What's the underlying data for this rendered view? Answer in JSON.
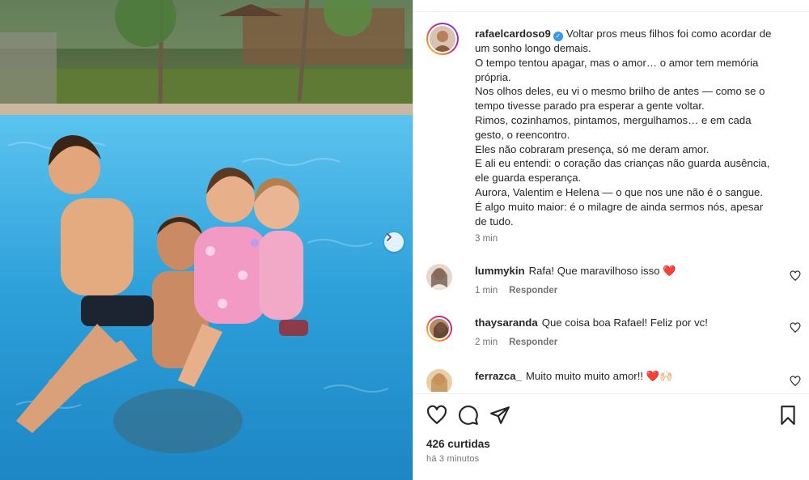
{
  "post": {
    "username": "rafaelcardoso9",
    "verified": true,
    "caption_lines": [
      "Voltar pros meus filhos foi como acordar de",
      "um sonho longo demais.",
      "O tempo tentou apagar, mas o amor… o amor tem memória",
      "própria.",
      "Nos olhos deles, eu vi o mesmo brilho de antes — como se o",
      "tempo tivesse parado pra esperar a gente voltar.",
      "Rimos, cozinhamos, pintamos, mergulhamos… e em cada",
      "gesto, o reencontro.",
      "Eles não cobraram presença, só me deram amor.",
      "E ali eu entendi: o coração das crianças não guarda ausência,",
      "ele guarda esperança.",
      "Aurora, Valentim e Helena — o que nos une não é o sangue.",
      "É algo muito maior: é o milagre de ainda sermos nós, apesar",
      "de tudo."
    ],
    "caption_time": "3 min"
  },
  "comments": [
    {
      "username": "lummykin",
      "text": "Rafa! Que maravilhoso isso ❤️",
      "time": "1 min",
      "reply_label": "Responder"
    },
    {
      "username": "thaysaranda",
      "text": "Que coisa boa Rafael! Feliz por vc!",
      "time": "2 min",
      "reply_label": "Responder"
    },
    {
      "username": "ferrazca_",
      "text": "Muito muito muito amor!! ❤️🙌🏻",
      "time": "",
      "reply_label": ""
    }
  ],
  "stats": {
    "likes": "426 curtidas",
    "posted_ago": "há 3 minutos"
  },
  "icons": {
    "verified": "verified-badge-icon",
    "like": "heart-icon",
    "comment": "comment-bubble-icon",
    "share": "paper-plane-icon",
    "save": "bookmark-icon",
    "next": "chevron-right-icon"
  },
  "colors": {
    "accent": "#3897f0",
    "like_red": "#ed4956",
    "muted": "#737373",
    "pool": "#3aa7dd"
  }
}
